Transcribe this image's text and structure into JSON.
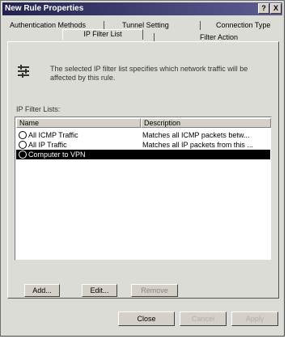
{
  "window": {
    "title": "New Rule Properties",
    "help_glyph": "?",
    "close_glyph": "X"
  },
  "tabs": {
    "row1": [
      "Authentication Methods",
      "Tunnel Setting",
      "Connection Type"
    ],
    "row2_active": "IP Filter List",
    "row2_other": "Filter Action"
  },
  "panel": {
    "description": "The selected IP filter list specifies which network traffic will be affected by this rule.",
    "list_label": "IP Filter Lists:",
    "columns": [
      "Name",
      "Description"
    ],
    "rows": [
      {
        "name": "All ICMP Traffic",
        "description": "Matches all ICMP packets betw...",
        "selected": false
      },
      {
        "name": "All IP Traffic",
        "description": "Matches all IP packets from this ...",
        "selected": false
      },
      {
        "name": "Computer to VPN",
        "description": "",
        "selected": true
      }
    ],
    "buttons": {
      "add": "Add...",
      "edit": "Edit...",
      "remove": "Remove"
    }
  },
  "footer": {
    "close": "Close",
    "cancel": "Cancel",
    "apply": "Apply"
  }
}
